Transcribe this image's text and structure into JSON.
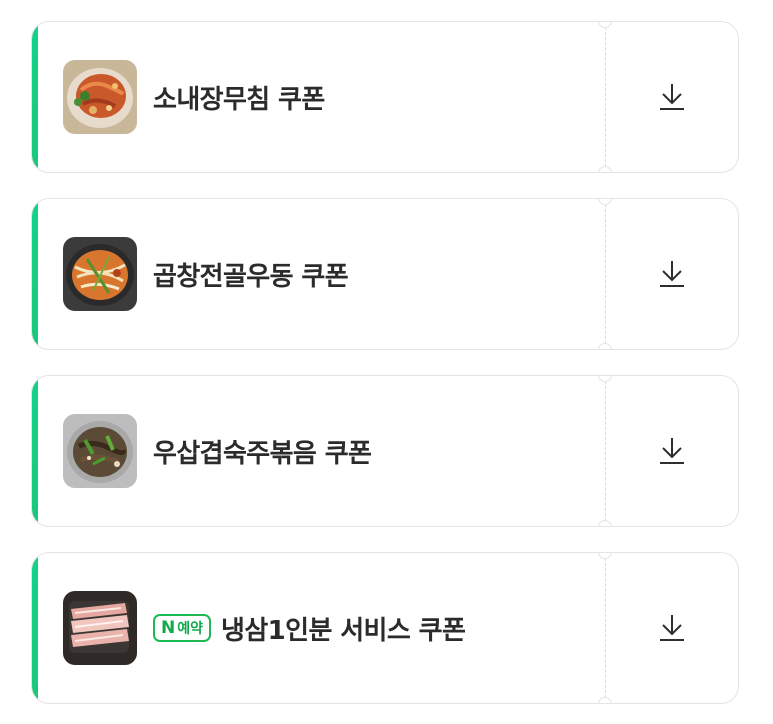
{
  "coupons": [
    {
      "title": "소내장무침 쿠폰",
      "badge": null,
      "image": "spicy-beef-tripe-salad",
      "download_icon": "download-icon"
    },
    {
      "title": "곱창전골우동 쿠폰",
      "badge": null,
      "image": "tripe-hotpot-udon",
      "download_icon": "download-icon"
    },
    {
      "title": "우삽겹숙주볶음 쿠폰",
      "badge": null,
      "image": "beef-belly-bean-sprout-stir-fry",
      "download_icon": "download-icon"
    },
    {
      "title": "냉삼1인분 서비스 쿠폰",
      "badge": {
        "n": "N",
        "label": "예약"
      },
      "image": "frozen-pork-belly",
      "download_icon": "download-icon"
    }
  ],
  "colors": {
    "accent": "#15cf83",
    "badge_green": "#1db954",
    "title_text": "#2b2b2b",
    "border": "#e4e4e4"
  }
}
